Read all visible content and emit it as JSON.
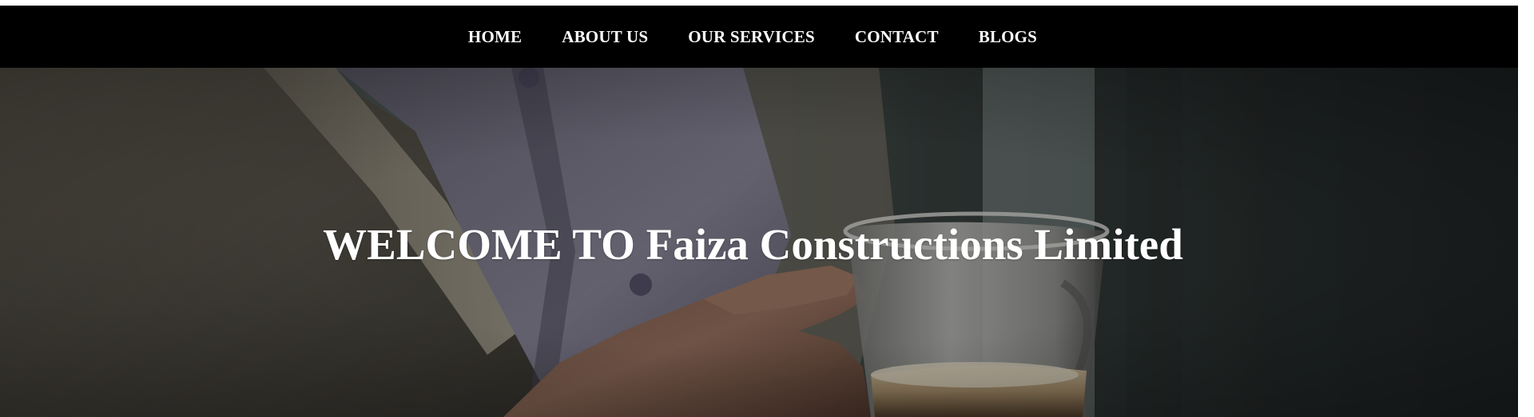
{
  "nav": {
    "items": [
      {
        "label": "HOME"
      },
      {
        "label": "ABOUT US"
      },
      {
        "label": "OUR SERVICES"
      },
      {
        "label": "CONTACT"
      },
      {
        "label": "BLOGS"
      }
    ]
  },
  "hero": {
    "title": "WELCOME TO Faiza Constructions Limited",
    "background": "photo of a person in a grey suit jacket and white shirt holding a glass cup of coffee, darkened overlay"
  },
  "colors": {
    "nav_background": "#000000",
    "nav_text": "#ffffff",
    "hero_text": "#ffffff",
    "page_background": "#ffffff"
  }
}
